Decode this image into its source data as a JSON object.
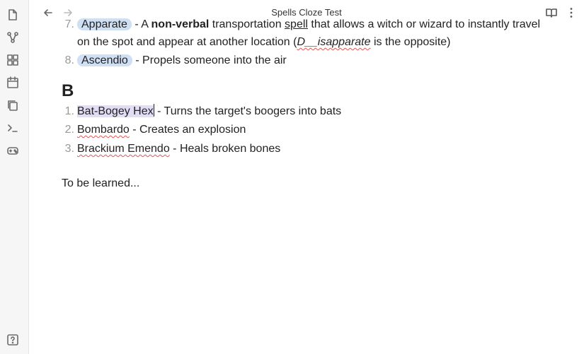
{
  "header": {
    "title": "Spells Cloze Test"
  },
  "ribbon": {
    "icons": [
      "files-icon",
      "graph-icon",
      "blocks-icon",
      "calendar-icon",
      "copy-icon",
      "terminal-icon",
      "gamepad-icon"
    ],
    "help_icon": "help-icon"
  },
  "doc": {
    "item7": {
      "number": "7.",
      "term": "Apparate",
      "sep": " - A ",
      "bold": "non-verbal",
      "rest": " transportation ",
      "link": "spell",
      "rest2": " that allows a witch or wizard to instantly travel",
      "line2_start": "on the spot and appear at another location (",
      "italic": "D__isapparate",
      "line2_end": " is the opposite)"
    },
    "item8": {
      "number": "8.",
      "term": "Ascendio",
      "desc": " - Propels someone into the air"
    },
    "section_heading": "B",
    "b_items": [
      {
        "number": "1.",
        "term_a": "Bat-Boge",
        "term_b": "y Hex",
        "desc": " - Turns the target's boogers into bats"
      },
      {
        "number": "2.",
        "term": "Bombardo",
        "desc": " - Creates an explosion"
      },
      {
        "number": "3.",
        "term": "Brackium Emendo",
        "desc": " - Heals broken bones"
      }
    ],
    "footer_text": "To be learned..."
  }
}
